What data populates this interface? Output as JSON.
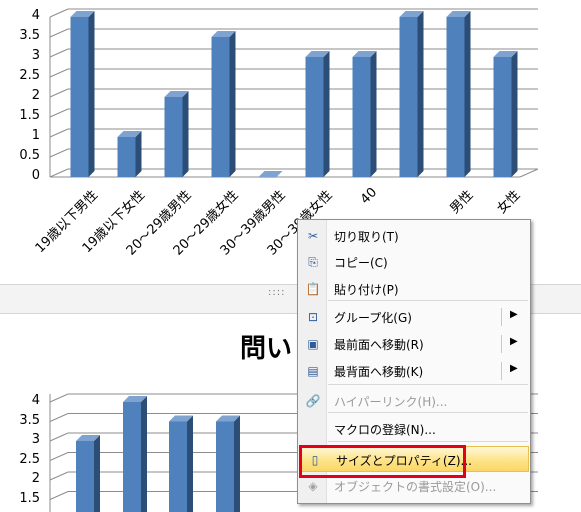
{
  "chart_data": [
    {
      "type": "bar",
      "title": "",
      "xlabel": "",
      "ylabel": "",
      "ylim": [
        0,
        4
      ],
      "yticks": [
        "0",
        "0.5",
        "1",
        "1.5",
        "2",
        "2.5",
        "3",
        "3.5",
        "4"
      ],
      "categories": [
        "19歳以下男性",
        "19歳以下女性",
        "20～29歳男性",
        "20～29歳女性",
        "30～39歳男性",
        "30～39歳女性",
        "40",
        "",
        "男性",
        "女性"
      ],
      "values": [
        4,
        1,
        2,
        3.5,
        0,
        3,
        3,
        4,
        4,
        3
      ],
      "color": "#4f81bd",
      "grid": true
    },
    {
      "type": "bar",
      "title": "問い",
      "xlabel": "",
      "ylabel": "",
      "ylim": [
        1.5,
        4
      ],
      "yticks": [
        "1.5",
        "2",
        "2.5",
        "3",
        "3.5",
        "4"
      ],
      "values": [
        3,
        4,
        3.5,
        3.5
      ],
      "color": "#4f81bd",
      "grid": true
    }
  ],
  "divider": {
    "handle": "::::"
  },
  "context_menu": {
    "items": [
      {
        "label": "切り取り(T)",
        "icon": "scissors-icon",
        "glyph": "✂",
        "enabled": true,
        "submenu": false
      },
      {
        "label": "コピー(C)",
        "icon": "copy-icon",
        "glyph": "⎘",
        "enabled": true,
        "submenu": false
      },
      {
        "label": "貼り付け(P)",
        "icon": "paste-icon",
        "glyph": "📋",
        "enabled": true,
        "submenu": false
      },
      {
        "label": "グループ化(G)",
        "icon": "group-icon",
        "glyph": "⊡",
        "enabled": true,
        "submenu": true
      },
      {
        "label": "最前面へ移動(R)",
        "icon": "bring-front-icon",
        "glyph": "▣",
        "enabled": true,
        "submenu": true
      },
      {
        "label": "最背面へ移動(K)",
        "icon": "send-back-icon",
        "glyph": "▤",
        "enabled": true,
        "submenu": true
      },
      {
        "label": "ハイパーリンク(H)...",
        "icon": "hyperlink-icon",
        "glyph": "🔗",
        "enabled": false,
        "submenu": false
      },
      {
        "label": "マクロの登録(N)...",
        "icon": "",
        "glyph": "",
        "enabled": true,
        "submenu": false
      },
      {
        "label": "サイズとプロパティ(Z)...",
        "icon": "size-properties-icon",
        "glyph": "▯",
        "enabled": true,
        "submenu": false,
        "highlighted": true
      },
      {
        "label": "オブジェクトの書式設定(O)...",
        "icon": "format-object-icon",
        "glyph": "◈",
        "enabled": false,
        "submenu": false
      }
    ],
    "submenu_arrow": "▶"
  },
  "colors": {
    "bar": "#4f81bd",
    "bar_side": "#2c4d75",
    "bar_top": "#7fa3d1",
    "highlight": "#fcd766",
    "annotation": "#e3001b"
  }
}
